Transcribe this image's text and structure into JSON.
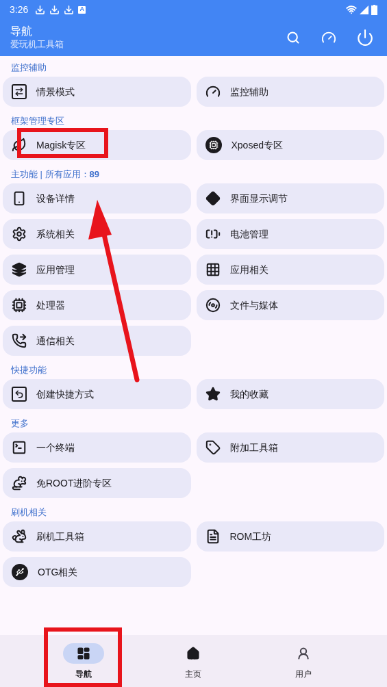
{
  "status_bar": {
    "time": "3:26",
    "notification_badge": "A"
  },
  "app_bar": {
    "title": "导航",
    "subtitle": "爱玩机工具箱"
  },
  "sections": [
    {
      "title": "监控辅助",
      "items": [
        {
          "label": "情景模式",
          "highlighted": false
        },
        {
          "label": "监控辅助",
          "highlighted": false
        }
      ]
    },
    {
      "title": "框架管理专区",
      "items": [
        {
          "label": "Magisk专区",
          "highlighted": true
        },
        {
          "label": "Xposed专区",
          "highlighted": false
        }
      ]
    },
    {
      "title": "主功能 | 所有应用：**89**",
      "items": [
        {
          "label": "设备详情",
          "highlighted": false
        },
        {
          "label": "界面显示调节",
          "highlighted": false
        },
        {
          "label": "系统相关",
          "highlighted": false
        },
        {
          "label": "电池管理",
          "highlighted": false
        },
        {
          "label": "应用管理",
          "highlighted": false
        },
        {
          "label": "应用相关",
          "highlighted": false
        },
        {
          "label": "处理器",
          "highlighted": false
        },
        {
          "label": "文件与媒体",
          "highlighted": false
        },
        {
          "label": "通信相关",
          "highlighted": false
        }
      ]
    },
    {
      "title": "快捷功能",
      "items": [
        {
          "label": "创建快捷方式",
          "highlighted": false
        },
        {
          "label": "我的收藏",
          "highlighted": false
        }
      ]
    },
    {
      "title": "更多",
      "items": [
        {
          "label": "一个终端",
          "highlighted": false
        },
        {
          "label": "附加工具箱",
          "highlighted": false
        },
        {
          "label": "免ROOT进阶专区",
          "highlighted": false
        }
      ]
    },
    {
      "title": "刷机相关",
      "items": [
        {
          "label": "刷机工具箱",
          "highlighted": false
        },
        {
          "label": "ROM工坊",
          "highlighted": false
        },
        {
          "label": "OTG相关",
          "highlighted": false
        }
      ]
    }
  ],
  "bottom_nav": [
    {
      "label": "导航",
      "selected": true,
      "highlighted": true
    },
    {
      "label": "主页",
      "selected": false,
      "highlighted": false
    },
    {
      "label": "用户",
      "selected": false,
      "highlighted": false
    }
  ],
  "annotations": [
    {
      "kind": "arrow"
    }
  ]
}
